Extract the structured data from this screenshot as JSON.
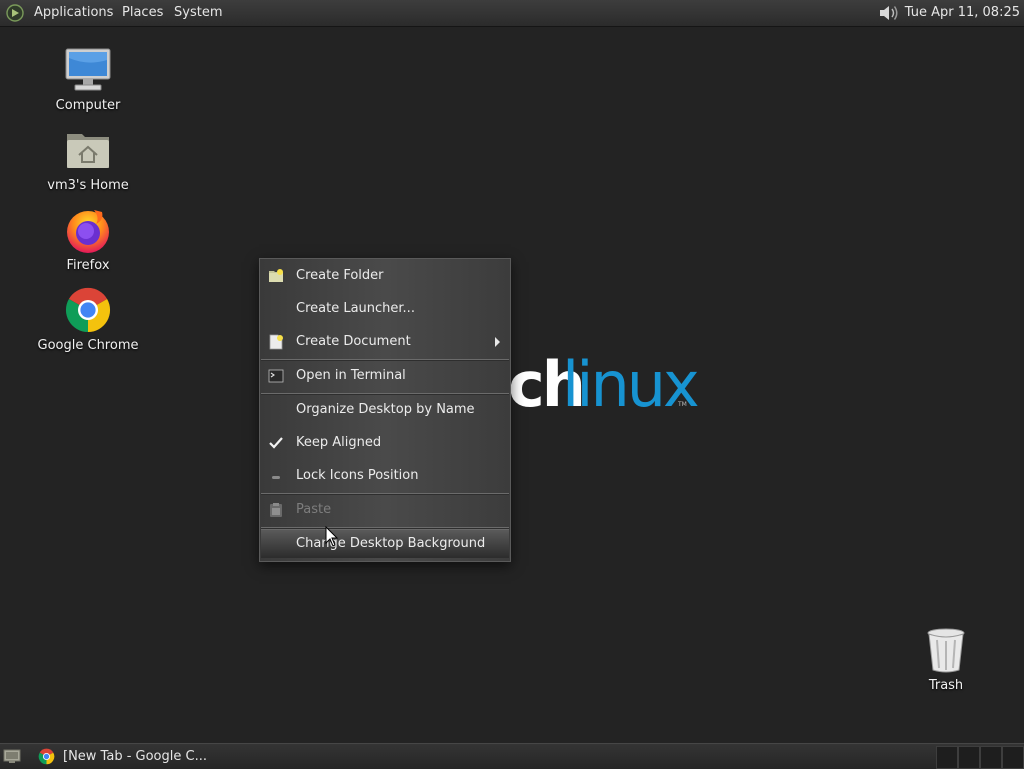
{
  "top_panel": {
    "menus": [
      "Applications",
      "Places",
      "System"
    ],
    "clock": "Tue Apr 11, 08:25",
    "icons": [
      "mate-logo-icon",
      "volume-icon"
    ]
  },
  "desktop": {
    "icons": [
      {
        "label": "Computer",
        "icon": "computer-icon"
      },
      {
        "label": "vm3's Home",
        "icon": "home-folder-icon"
      },
      {
        "label": "Firefox",
        "icon": "firefox-icon"
      },
      {
        "label": "Google Chrome",
        "icon": "chrome-icon"
      },
      {
        "label": "Trash",
        "icon": "trash-icon"
      }
    ],
    "wallpaper_text": {
      "left": "ch",
      "right": "linux",
      "tm": "TM"
    },
    "wallpaper_colors": {
      "bold": "#ffffff",
      "light": "#1793d1"
    }
  },
  "context_menu": {
    "items": [
      {
        "label": "Create Folder",
        "icon": "folder-new-icon"
      },
      {
        "label": "Create Launcher...",
        "icon": ""
      },
      {
        "label": "Create Document",
        "icon": "document-new-icon",
        "submenu": true
      },
      {
        "label": "Open in Terminal",
        "icon": "terminal-icon"
      },
      {
        "label": "Organize Desktop by Name",
        "icon": ""
      },
      {
        "label": "Keep Aligned",
        "icon": "checkmark-icon",
        "checked": true
      },
      {
        "label": "Lock Icons Position",
        "icon": "toggle-off-icon"
      },
      {
        "label": "Paste",
        "icon": "paste-icon",
        "disabled": true
      },
      {
        "label": "Change Desktop Background",
        "icon": "",
        "highlighted": true
      }
    ]
  },
  "bottom_panel": {
    "task": {
      "label": "[New Tab - Google C...",
      "icon": "chrome-icon"
    },
    "workspaces": 4
  }
}
